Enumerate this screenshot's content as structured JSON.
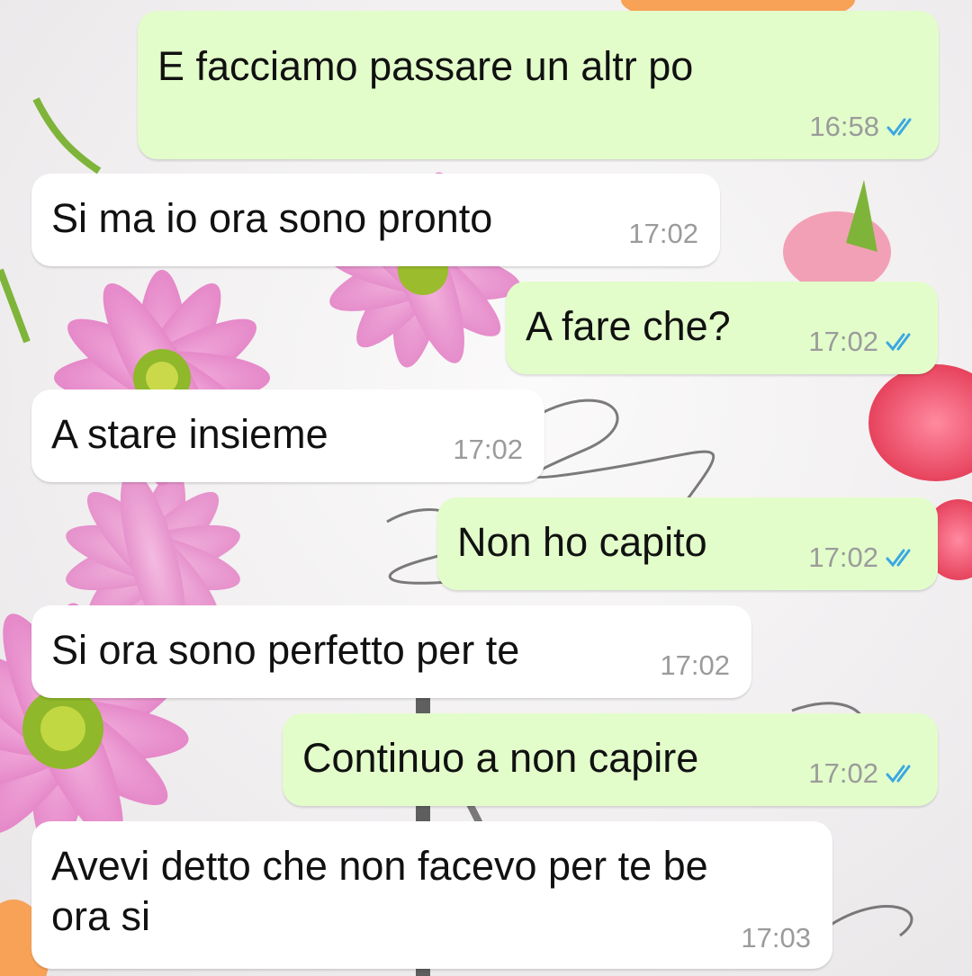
{
  "colors": {
    "outgoing_bubble": "#e2fdca",
    "incoming_bubble": "#ffffff",
    "timestamp": "#9b9b9b",
    "read_ticks": "#3aa7e3"
  },
  "wallpaper": {
    "description_icon": "flowers-wallpaper"
  },
  "messages": [
    {
      "direction": "outgoing",
      "text": "E facciamo passare un altr po",
      "time": "16:58",
      "status_icon": "double-check-read-icon"
    },
    {
      "direction": "incoming",
      "text": "Si ma io ora sono pronto",
      "time": "17:02"
    },
    {
      "direction": "outgoing",
      "text": "A fare che?",
      "time": "17:02",
      "status_icon": "double-check-read-icon"
    },
    {
      "direction": "incoming",
      "text": "A stare insieme",
      "time": "17:02"
    },
    {
      "direction": "outgoing",
      "text": "Non ho capito",
      "time": "17:02",
      "status_icon": "double-check-read-icon"
    },
    {
      "direction": "incoming",
      "text": "Si ora sono perfetto per te",
      "time": "17:02"
    },
    {
      "direction": "outgoing",
      "text": "Continuo a non capire",
      "time": "17:02",
      "status_icon": "double-check-read-icon"
    },
    {
      "direction": "incoming",
      "text": "Avevi detto che non facevo per te be\nora si",
      "time": "17:03"
    }
  ]
}
